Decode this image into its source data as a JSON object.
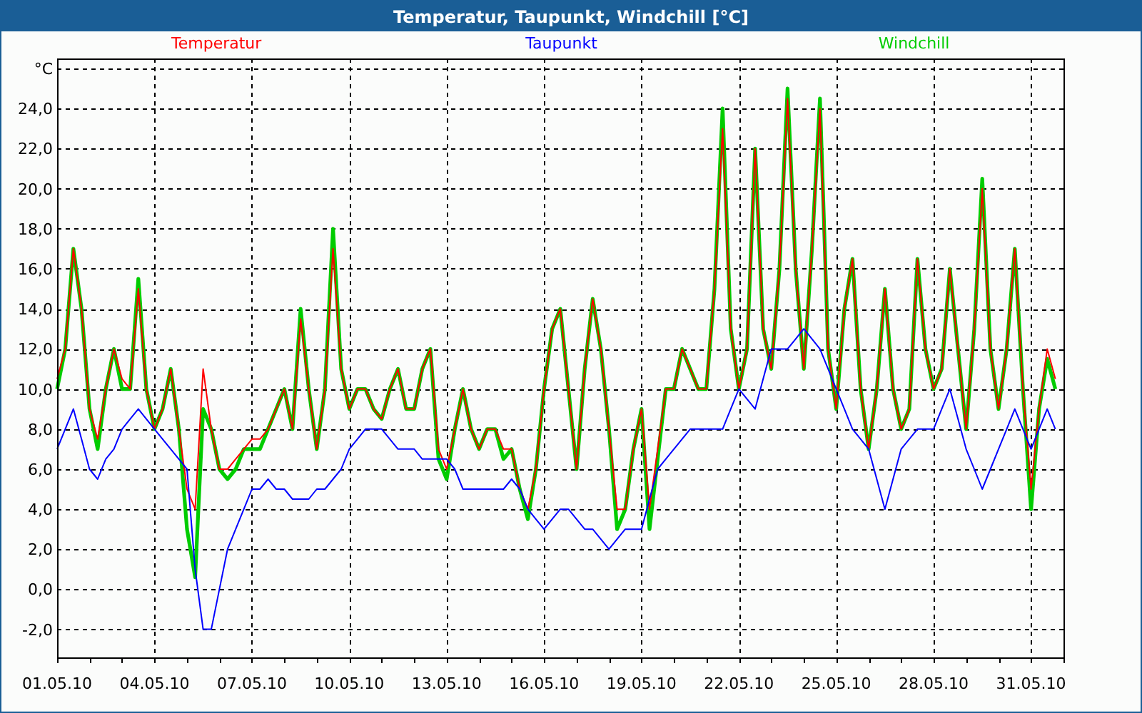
{
  "window": {
    "title": "Temperatur, Taupunkt, Windchill [°C]"
  },
  "chart": {
    "chart_data": {
      "type": "line",
      "ylabel": "°C",
      "categories": [
        "01.05.10",
        null,
        null,
        null,
        null,
        null,
        null,
        null,
        null,
        null,
        null,
        null,
        "04.05.10",
        null,
        null,
        null,
        null,
        null,
        null,
        null,
        null,
        null,
        null,
        null,
        "07.05.10",
        null,
        null,
        null,
        null,
        null,
        null,
        null,
        null,
        null,
        null,
        null,
        "10.05.10",
        null,
        null,
        null,
        null,
        null,
        null,
        null,
        null,
        null,
        null,
        null,
        "13.05.10",
        null,
        null,
        null,
        null,
        null,
        null,
        null,
        null,
        null,
        null,
        null,
        "16.05.10",
        null,
        null,
        null,
        null,
        null,
        null,
        null,
        null,
        null,
        null,
        null,
        "19.05.10",
        null,
        null,
        null,
        null,
        null,
        null,
        null,
        null,
        null,
        null,
        null,
        "22.05.10",
        null,
        null,
        null,
        null,
        null,
        null,
        null,
        null,
        null,
        null,
        null,
        "25.05.10",
        null,
        null,
        null,
        null,
        null,
        null,
        null,
        null,
        null,
        null,
        null,
        "28.05.10",
        null,
        null,
        null,
        null,
        null,
        null,
        null,
        null,
        null,
        null,
        null,
        "31.05.10",
        null,
        null,
        null
      ],
      "series": [
        {
          "name": "Temperatur",
          "color": "#ff0000",
          "values": [
            10.5,
            12,
            17,
            14,
            9,
            7.5,
            10,
            12,
            10.5,
            10,
            15,
            10,
            8,
            9,
            11,
            8,
            5,
            4,
            11,
            8,
            6,
            6,
            6.5,
            7,
            7.5,
            7.5,
            8,
            9,
            10,
            8,
            13.5,
            10,
            7,
            10,
            17,
            11,
            9,
            10,
            10,
            9,
            8.5,
            10,
            11,
            9,
            9,
            11,
            12,
            7,
            6,
            8,
            10,
            8,
            7,
            8,
            8,
            7,
            7,
            5,
            4,
            6,
            10,
            13,
            14,
            10,
            6,
            11,
            14.5,
            12,
            8,
            4,
            4,
            7,
            9,
            4,
            7,
            10,
            10,
            12,
            11,
            10,
            10,
            15,
            23,
            13,
            10,
            12,
            22,
            13,
            11,
            16,
            24.5,
            16,
            11,
            17,
            24,
            12,
            9,
            14,
            16.5,
            10,
            7,
            10,
            15,
            10,
            8,
            9,
            16.5,
            12,
            10,
            11,
            16,
            12,
            8,
            13,
            20,
            12,
            9,
            12,
            17,
            10,
            5,
            9,
            12,
            10.5
          ]
        },
        {
          "name": "Taupunkt",
          "color": "#0000ff",
          "values": [
            7,
            8,
            9,
            7.5,
            6,
            5.5,
            6.5,
            7,
            8,
            8.5,
            9,
            8.5,
            8,
            7.5,
            7,
            6.5,
            6,
            1,
            -2,
            -2,
            0,
            2,
            3,
            4,
            5,
            5,
            5.5,
            5,
            5,
            4.5,
            4.5,
            4.5,
            5,
            5,
            5.5,
            6,
            7,
            7.5,
            8,
            8,
            8,
            7.5,
            7,
            7,
            7,
            6.5,
            6.5,
            6.5,
            6.5,
            6,
            5,
            5,
            5,
            5,
            5,
            5,
            5.5,
            5,
            4,
            3.5,
            3,
            3.5,
            4,
            4,
            3.5,
            3,
            3,
            2.5,
            2,
            2.5,
            3,
            3,
            3,
            4.5,
            6,
            6.5,
            7,
            7.5,
            8,
            8,
            8,
            8,
            8,
            9,
            10,
            9.5,
            9,
            10.5,
            12,
            12,
            12,
            12.5,
            13,
            12.5,
            12,
            11,
            10,
            9,
            8,
            7.5,
            7,
            5.5,
            4,
            5.5,
            7,
            7.5,
            8,
            8,
            8,
            9,
            10,
            8.5,
            7,
            6,
            5,
            6,
            7,
            8,
            9,
            8,
            7,
            8,
            9,
            8
          ]
        },
        {
          "name": "Windchill",
          "color": "#00cc00",
          "values": [
            10,
            12,
            17,
            14,
            9,
            7,
            10,
            12,
            10,
            10,
            15.5,
            10,
            8,
            9,
            11,
            8,
            3,
            0.6,
            9,
            8,
            6,
            5.5,
            6,
            7,
            7,
            7,
            8,
            9,
            10,
            8,
            14,
            10,
            7,
            10,
            18,
            11,
            9,
            10,
            10,
            9,
            8.5,
            10,
            11,
            9,
            9,
            11,
            12,
            6.5,
            5.5,
            8,
            10,
            8,
            7,
            8,
            8,
            6.5,
            7,
            5,
            3.5,
            6,
            10,
            13,
            14,
            10,
            6,
            11,
            14.5,
            12,
            8,
            3,
            4,
            7,
            9,
            3,
            6.5,
            10,
            10,
            12,
            11,
            10,
            10,
            15,
            24,
            13,
            10,
            12,
            22,
            13,
            11,
            16,
            25,
            16,
            11,
            17,
            24.5,
            12,
            9,
            14,
            16.5,
            10,
            7,
            10,
            15,
            10,
            8,
            9,
            16.5,
            12,
            10,
            11,
            16,
            12,
            8,
            13,
            20.5,
            12,
            9,
            12,
            17,
            10,
            4,
            9,
            11.5,
            10
          ]
        }
      ],
      "grid": true,
      "ylim": [
        -3.4,
        26.5
      ],
      "yticks": [
        {
          "value": -2,
          "label": "-2,0"
        },
        {
          "value": 0,
          "label": "0,0"
        },
        {
          "value": 2,
          "label": "2,0"
        },
        {
          "value": 4,
          "label": "4,0"
        },
        {
          "value": 6,
          "label": "6,0"
        },
        {
          "value": 8,
          "label": "8,0"
        },
        {
          "value": 10,
          "label": "10,0"
        },
        {
          "value": 12,
          "label": "12,0"
        },
        {
          "value": 14,
          "label": "14,0"
        },
        {
          "value": 16,
          "label": "16,0"
        },
        {
          "value": 18,
          "label": "18,0"
        },
        {
          "value": 20,
          "label": "20,0"
        },
        {
          "value": 22,
          "label": "22,0"
        },
        {
          "value": 24,
          "label": "24,0"
        }
      ]
    }
  }
}
